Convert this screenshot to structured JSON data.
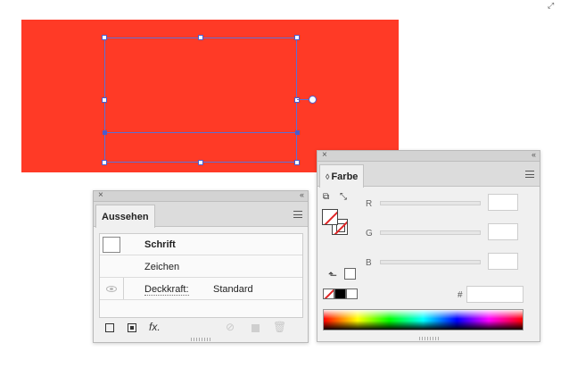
{
  "window": {
    "corner_mark": "⤢"
  },
  "canvas": {
    "artboard_color": "#ff3a26",
    "selection_color": "#4a5ccc"
  },
  "aussehen": {
    "close_glyph": "×",
    "collapse_glyph": "‹‹",
    "tab_label": "Aussehen",
    "rows": {
      "fill_label": "Schrift",
      "char_label": "Zeichen",
      "opacity_label": "Deckkraft:",
      "opacity_value": "Standard"
    },
    "toolbar": {
      "fx_label": "fx."
    },
    "icons": [
      "menu-icon",
      "eye-icon",
      "add-stroke-icon",
      "add-fill-icon",
      "fx-icon",
      "clear-icon",
      "duplicate-icon",
      "trash-icon"
    ]
  },
  "farbe": {
    "close_glyph": "×",
    "collapse_glyph": "‹‹",
    "tab_arrows": "◊",
    "tab_label": "Farbe",
    "swap_glyph": "⤡",
    "default_glyph": "⮌",
    "sliders": {
      "r": "R",
      "g": "G",
      "b": "B"
    },
    "hash_label": "#",
    "out_of_gamut_glyph": "⬑",
    "hex_value": "",
    "swatches": [
      "none",
      "black",
      "white"
    ]
  }
}
